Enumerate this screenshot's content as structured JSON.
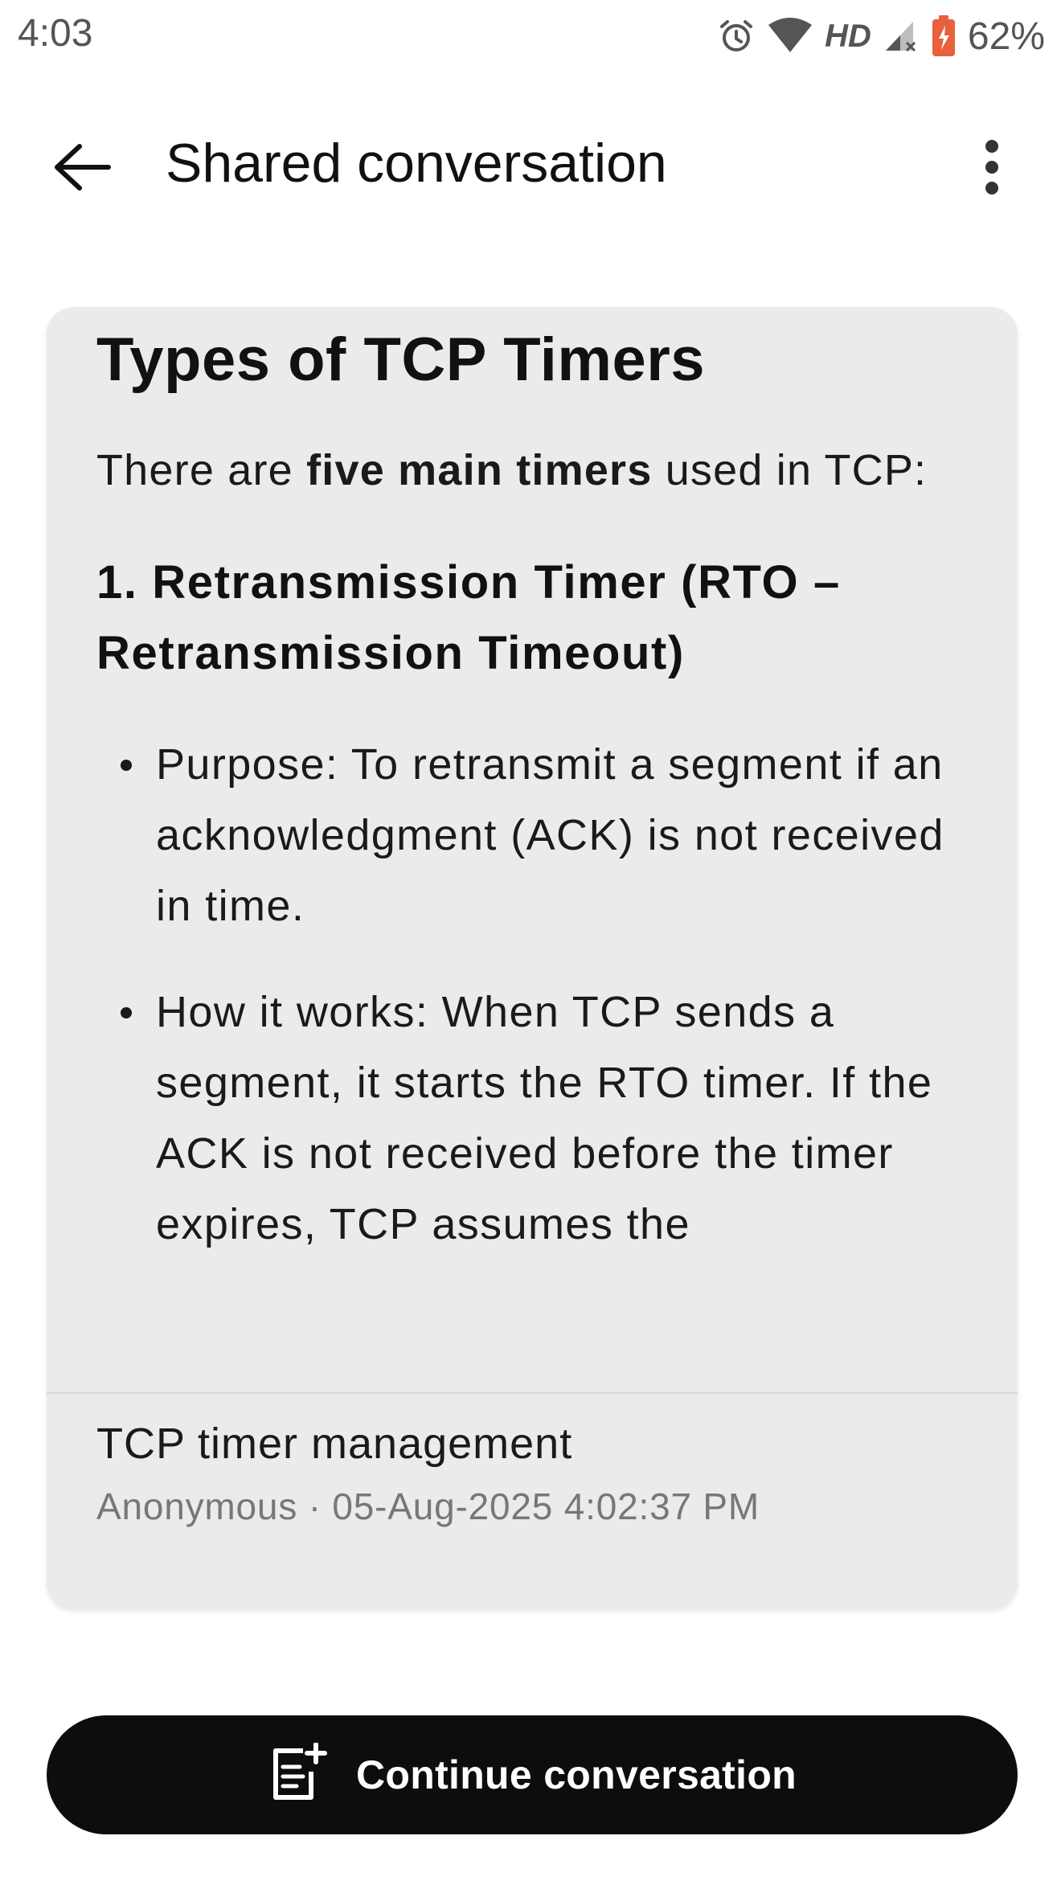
{
  "status_bar": {
    "time": "4:03",
    "network_label": "HD",
    "battery_percent": "62%",
    "icons": [
      "alarm-icon",
      "wifi-icon",
      "cell-signal-icon",
      "battery-icon"
    ],
    "battery_color": "#e8603c"
  },
  "app_bar": {
    "title": "Shared conversation",
    "back_icon": "arrow-back-icon",
    "more_icon": "more-vert-icon"
  },
  "card": {
    "content": {
      "title": "Types of TCP Timers",
      "intro_before": "There are ",
      "intro_bold": "five main timers",
      "intro_after": " used in TCP:",
      "section_heading": "1. Retransmission Timer (RTO – Retransmission Timeout)",
      "bullets": [
        "Purpose: To retransmit a segment if an acknowledgment (ACK) is not received in time.",
        "How it works: When TCP sends a segment, it starts the RTO timer. If the ACK is not received before the timer expires, TCP assumes the"
      ]
    },
    "footer": {
      "conversation_title": "TCP timer management",
      "meta": "Anonymous · 05-Aug-2025 4:02:37 PM"
    },
    "background": "#ebebeb"
  },
  "continue_button": {
    "label": "Continue conversation",
    "icon": "new-note-icon",
    "background": "#0d0d0d"
  }
}
